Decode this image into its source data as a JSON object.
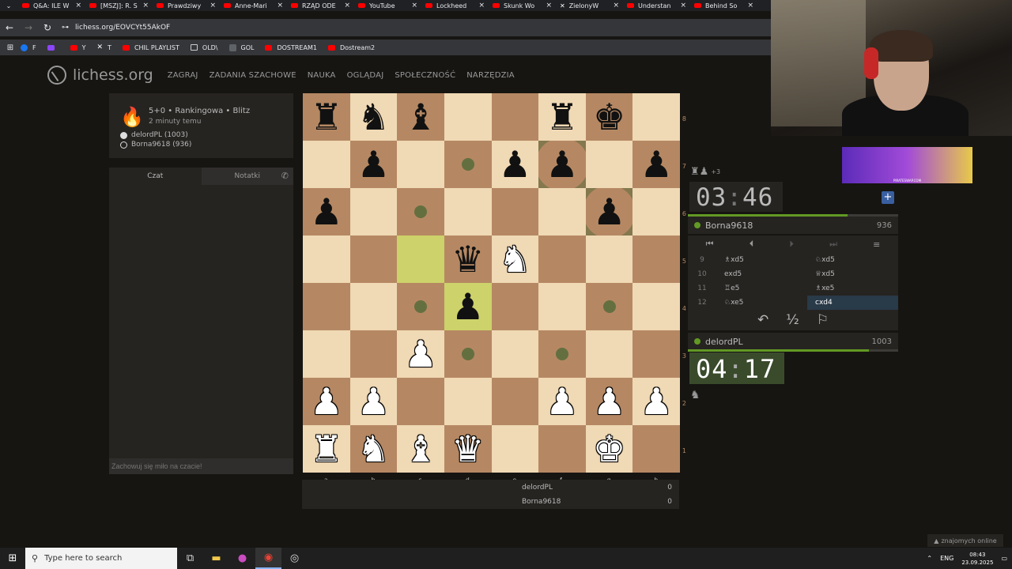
{
  "browser": {
    "tabs": [
      "Q&A: ILE W",
      "[MSZJ]: R. S",
      "Prawdziwy",
      "Anne-Mari",
      "RZĄD ODE",
      "YouTube",
      "Lockheed",
      "Skunk Wo",
      "ZielonyW",
      "Understan",
      "Behind So"
    ],
    "url": "lichess.org/EOVCYt55AkOF",
    "bookmarks": [
      "F",
      "",
      "Y",
      "T",
      "CHIL PLAYLIST",
      "OLD\\",
      "GOL",
      "DOSTREAM1",
      "Dostream2"
    ]
  },
  "site": {
    "logo": "lichess.org",
    "nav": [
      "ZAGRAJ",
      "ZADANIA SZACHOWE",
      "NAUKA",
      "OGLĄDAJ",
      "SPOŁECZNOŚĆ",
      "NARZĘDZIA"
    ]
  },
  "game_info": {
    "title": "5+0 • Rankingowa • Blitz",
    "time_ago": "2 minuty temu",
    "white_player": "delordPL (1003)",
    "black_player": "Borna9618 (936)"
  },
  "chat": {
    "tab_chat": "Czat",
    "tab_notes": "Notatki",
    "placeholder": "Zachowuj się miło na czacie!"
  },
  "board": {
    "ranks": [
      "8",
      "7",
      "6",
      "5",
      "4",
      "3",
      "2",
      "1"
    ],
    "files": [
      "a",
      "b",
      "c",
      "d",
      "e",
      "f",
      "g",
      "h"
    ],
    "pieces": [
      {
        "sq": "a8",
        "p": "♜",
        "c": "b"
      },
      {
        "sq": "b8",
        "p": "♞",
        "c": "b"
      },
      {
        "sq": "c8",
        "p": "♝",
        "c": "b"
      },
      {
        "sq": "f8",
        "p": "♜",
        "c": "b"
      },
      {
        "sq": "g8",
        "p": "♚",
        "c": "b"
      },
      {
        "sq": "b7",
        "p": "♟",
        "c": "b"
      },
      {
        "sq": "e7",
        "p": "♟",
        "c": "b"
      },
      {
        "sq": "f7",
        "p": "♟",
        "c": "b"
      },
      {
        "sq": "h7",
        "p": "♟",
        "c": "b"
      },
      {
        "sq": "a6",
        "p": "♟",
        "c": "b"
      },
      {
        "sq": "g6",
        "p": "♟",
        "c": "b"
      },
      {
        "sq": "d5",
        "p": "♛",
        "c": "b"
      },
      {
        "sq": "e5",
        "p": "♞",
        "c": "w"
      },
      {
        "sq": "d4",
        "p": "♟",
        "c": "b"
      },
      {
        "sq": "c3",
        "p": "♟",
        "c": "w"
      },
      {
        "sq": "a2",
        "p": "♟",
        "c": "w"
      },
      {
        "sq": "b2",
        "p": "♟",
        "c": "w"
      },
      {
        "sq": "f2",
        "p": "♟",
        "c": "w"
      },
      {
        "sq": "g2",
        "p": "♟",
        "c": "w"
      },
      {
        "sq": "h2",
        "p": "♟",
        "c": "w"
      },
      {
        "sq": "a1",
        "p": "♜",
        "c": "w"
      },
      {
        "sq": "b1",
        "p": "♞",
        "c": "w"
      },
      {
        "sq": "c1",
        "p": "♝",
        "c": "w"
      },
      {
        "sq": "d1",
        "p": "♛",
        "c": "w"
      },
      {
        "sq": "g1",
        "p": "♚",
        "c": "w"
      }
    ],
    "last_move": [
      "c5",
      "d4"
    ],
    "move_dests": [
      "d7",
      "c6",
      "c4",
      "g4",
      "d3",
      "f3"
    ],
    "capture_dests": [
      "f7",
      "g6"
    ]
  },
  "score": {
    "rows": [
      {
        "name": "delordPL",
        "value": "0"
      },
      {
        "name": "Borna9618",
        "value": "0"
      }
    ]
  },
  "top_player": {
    "material": "+3",
    "clock_min": "03",
    "clock_sec": "46",
    "time_fraction": 0.76,
    "name": "Borna9618",
    "rating": "936"
  },
  "moves": [
    {
      "n": "9",
      "w": "♗xd5",
      "b": "♘xd5"
    },
    {
      "n": "10",
      "w": "exd5",
      "b": "♕xd5"
    },
    {
      "n": "11",
      "w": "♖e5",
      "b": "♗xe5"
    },
    {
      "n": "12",
      "w": "♘xe5",
      "b": "cxd4"
    }
  ],
  "controls": {
    "takeback": "↶",
    "draw": "½",
    "resign": "⚐"
  },
  "bottom_player": {
    "name": "delordPL",
    "rating": "1003",
    "clock_min": "04",
    "clock_sec": "17",
    "time_fraction": 0.86
  },
  "ad": {
    "label": "PIRATESWAP.COM"
  },
  "friends": "znajomych online",
  "taskbar": {
    "search_placeholder": "Type here to search",
    "lang": "ENG",
    "time": "08:43",
    "date": "23.09.2025"
  }
}
